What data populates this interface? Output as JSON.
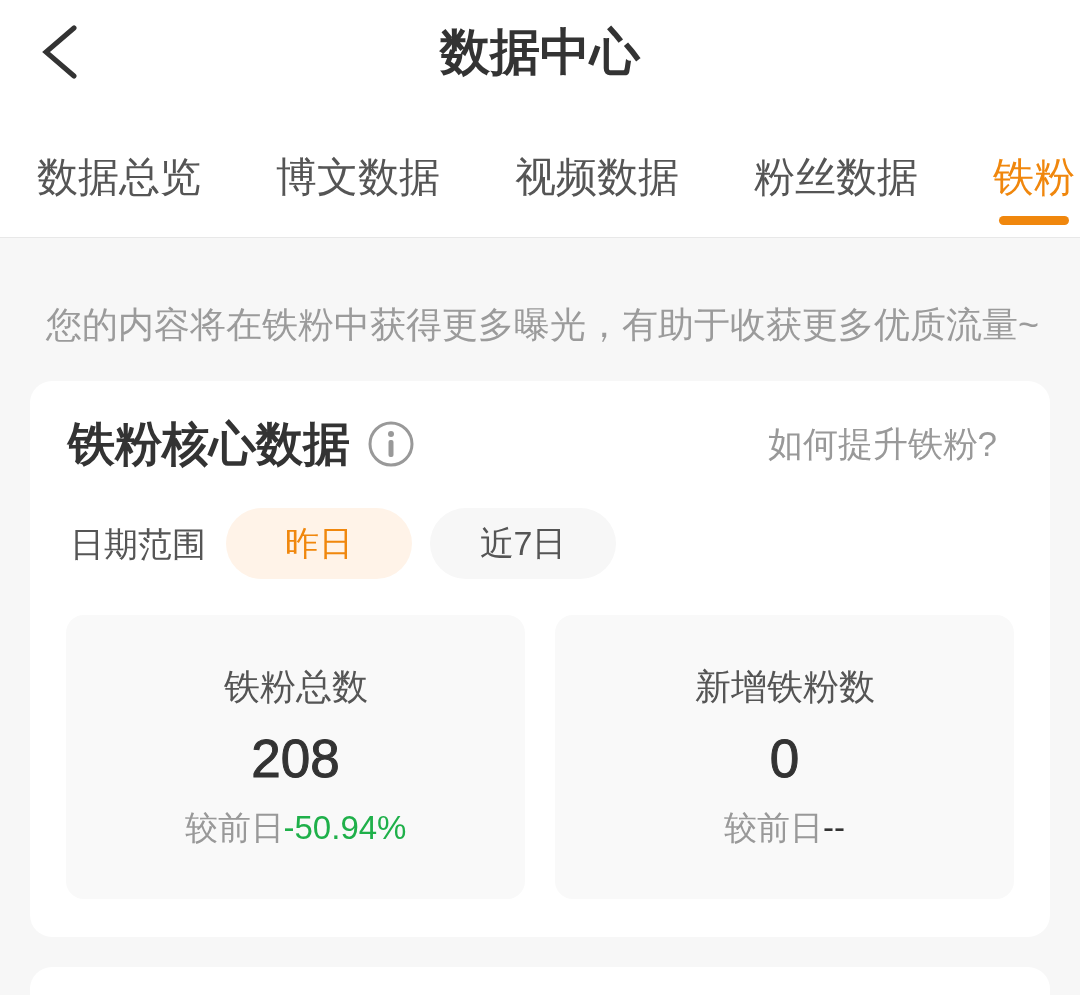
{
  "header": {
    "title": "数据中心"
  },
  "tabs": [
    {
      "label": "数据总览",
      "selected": false
    },
    {
      "label": "博文数据",
      "selected": false
    },
    {
      "label": "视频数据",
      "selected": false
    },
    {
      "label": "粉丝数据",
      "selected": false
    },
    {
      "label": "铁粉",
      "selected": true
    }
  ],
  "notice": "您的内容将在铁粉中获得更多曝光，有助于收获更多优质流量~",
  "core_card": {
    "title": "铁粉核心数据",
    "help_link": "如何提升铁粉?",
    "date_range": {
      "label": "日期范围",
      "options": [
        {
          "label": "昨日",
          "selected": true
        },
        {
          "label": "近7日",
          "selected": false
        }
      ]
    },
    "stats": [
      {
        "label": "铁粉总数",
        "value": "208",
        "compare_label": "较前日",
        "change": "-50.94%",
        "color": "#1fb04a"
      },
      {
        "label": "新增铁粉数",
        "value": "0",
        "compare_label": "较前日",
        "change": "--",
        "color": "#333333"
      }
    ]
  }
}
